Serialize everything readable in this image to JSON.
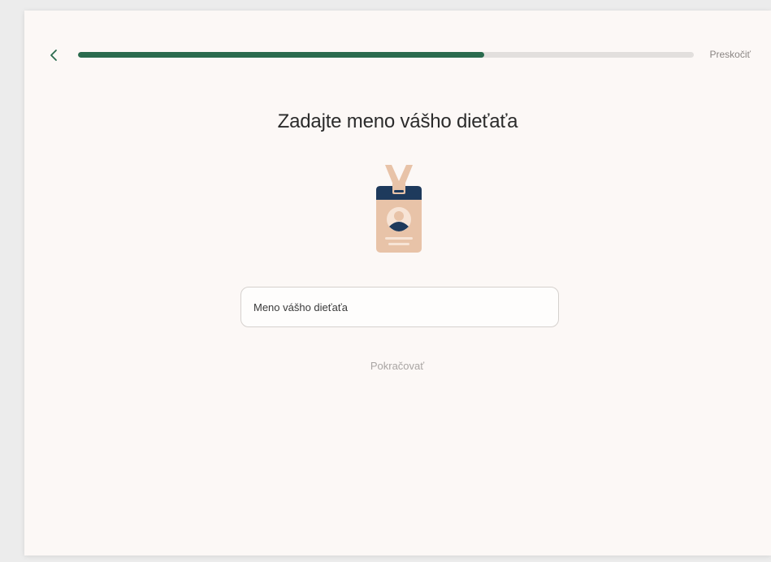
{
  "header": {
    "back_icon": "chevron-left-icon",
    "progress": 0.66,
    "skip_label": "Preskočiť"
  },
  "main": {
    "title": "Zadajte meno vášho dieťaťa",
    "illustration_icon": "id-badge-icon",
    "name_input": {
      "value": "",
      "placeholder": "Meno vášho dieťaťa"
    },
    "continue_label": "Pokračovať"
  },
  "colors": {
    "accent": "#2a6b4e",
    "progress_track": "#e2dfdd",
    "background": "#fcf8f6",
    "badge_navy": "#1e3a5c",
    "badge_peach": "#e8c3a8"
  }
}
